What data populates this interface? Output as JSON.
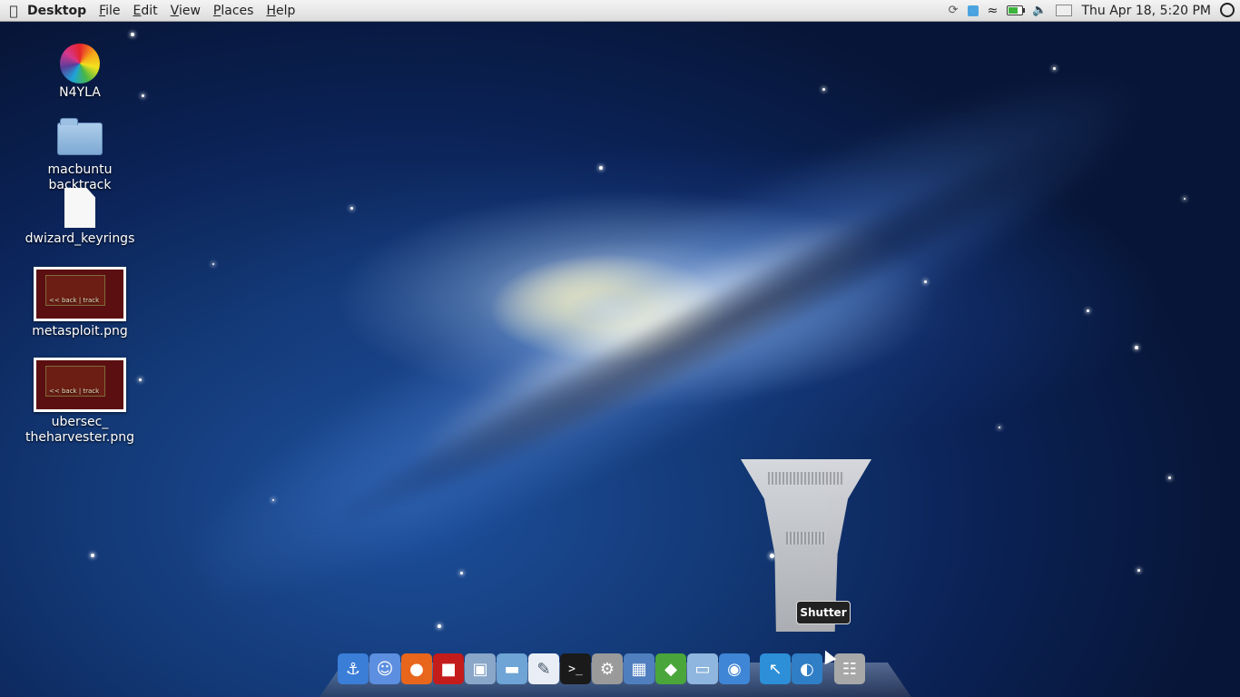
{
  "menubar": {
    "app_name": "Desktop",
    "menus": [
      "File",
      "Edit",
      "View",
      "Places",
      "Help"
    ],
    "clock": "Thu Apr 18,  5:20 PM",
    "battery_level": 0.7
  },
  "desktop_icons": [
    {
      "label": "N4YLA",
      "icon": "flower-logo-icon"
    },
    {
      "label": "macbuntu backtrack",
      "icon": "folder-icon"
    },
    {
      "label": "dwizard_keyrings",
      "icon": "document-icon"
    },
    {
      "label": "metasploit.png",
      "icon": "image-thumbnail-icon",
      "thumb_text": "<< back | track"
    },
    {
      "label": "ubersec_\ntheharvester.png",
      "label_lines": [
        "ubersec_",
        "theharvester.png"
      ],
      "icon": "image-thumbnail-icon",
      "thumb_text": "<< back | track"
    }
  ],
  "dock": {
    "tooltip": "Shutter",
    "items": [
      {
        "icon": "anchor-icon",
        "color": "#3a7ed8"
      },
      {
        "icon": "finder-icon",
        "color": "#5d8fe0"
      },
      {
        "icon": "firefox-icon",
        "color": "#e8661c"
      },
      {
        "icon": "photo-booth-icon",
        "color": "#c41b1b"
      },
      {
        "icon": "image-viewer-icon",
        "color": "#8aa6c8"
      },
      {
        "icon": "scanner-icon",
        "color": "#6fa4d6"
      },
      {
        "icon": "text-editor-icon",
        "color": "#e9eef6"
      },
      {
        "icon": "terminal-icon",
        "color": "#1a1a1a"
      },
      {
        "icon": "system-preferences-icon",
        "color": "#9a9a9a"
      },
      {
        "icon": "workspace-switcher-icon",
        "color": "#4f7fbf"
      },
      {
        "icon": "software-center-icon",
        "color": "#4aa63a"
      },
      {
        "icon": "home-folder-icon",
        "color": "#8fb6de"
      },
      {
        "icon": "chat-icon",
        "color": "#3f86d6"
      },
      {
        "icon": "cursor-app-icon",
        "color": "#2c8fd8"
      },
      {
        "icon": "shutter-icon",
        "color": "#2f7ec6"
      },
      {
        "icon": "trash-icon",
        "color": "#a8a8a8"
      }
    ]
  }
}
